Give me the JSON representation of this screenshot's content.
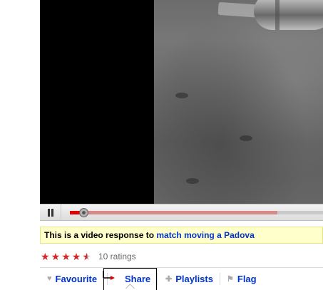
{
  "player": {
    "state": "playing",
    "progress": 0.04,
    "buffered": 0.82
  },
  "notice": {
    "prefix": "This is a video response to",
    "link": "match moving a Padova"
  },
  "rating": {
    "stars": 4.5,
    "count_text": "10 ratings"
  },
  "actions": {
    "favourite": "Favourite",
    "share": "Share",
    "playlists": "Playlists",
    "flag": "Flag"
  },
  "colors": {
    "link": "#0033cc",
    "notice_bg": "#ffffcc",
    "star": "#d42828",
    "progress_played": "#e00000",
    "progress_loaded": "#d68a8a"
  },
  "icons": {
    "favourite": "heart-icon",
    "playlists": "plus-icon",
    "flag": "flag-icon",
    "share": "share-arrow-icon",
    "pause": "pause-icon"
  }
}
